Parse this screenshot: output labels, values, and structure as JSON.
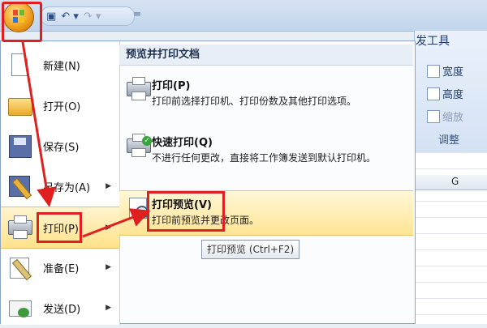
{
  "qat": {
    "save_icon": "save-icon",
    "undo": "↶ ▾",
    "redo": "↷ ▾",
    "more": "="
  },
  "ribbon": {
    "tab": "发工具",
    "cmd1": "宽度",
    "cmd2": "高度",
    "cmd3": "缩放",
    "group": "调整",
    "col_header": "G"
  },
  "menu": {
    "left_items": [
      {
        "label": "新建(N)",
        "icon": "new-document-icon"
      },
      {
        "label": "打开(O)",
        "icon": "open-folder-icon"
      },
      {
        "label": "保存(S)",
        "icon": "save-disk-icon"
      },
      {
        "label": "另存为(A)",
        "icon": "save-as-icon",
        "submenu": true
      },
      {
        "label": "打印(P)",
        "icon": "printer-icon",
        "submenu": true,
        "active": true
      },
      {
        "label": "准备(E)",
        "icon": "prepare-icon",
        "submenu": true
      },
      {
        "label": "发送(D)",
        "icon": "send-icon",
        "submenu": true
      }
    ],
    "submenu_arrow": "▶",
    "right_header": "预览并打印文档",
    "right_options": [
      {
        "title": "打印(P)",
        "desc": "打印前选择打印机、打印份数及其他打印选项。"
      },
      {
        "title": "快速打印(Q)",
        "desc": "不进行任何更改，直接将工作簿发送到默认打印机。"
      },
      {
        "title": "打印预览(V)",
        "desc": "打印前预览并更改页面。",
        "active": true
      }
    ],
    "tooltip": "打印预览 (Ctrl+F2)"
  },
  "colors": {
    "highlight": "#e02020",
    "active_bg": "#ffe28a"
  }
}
